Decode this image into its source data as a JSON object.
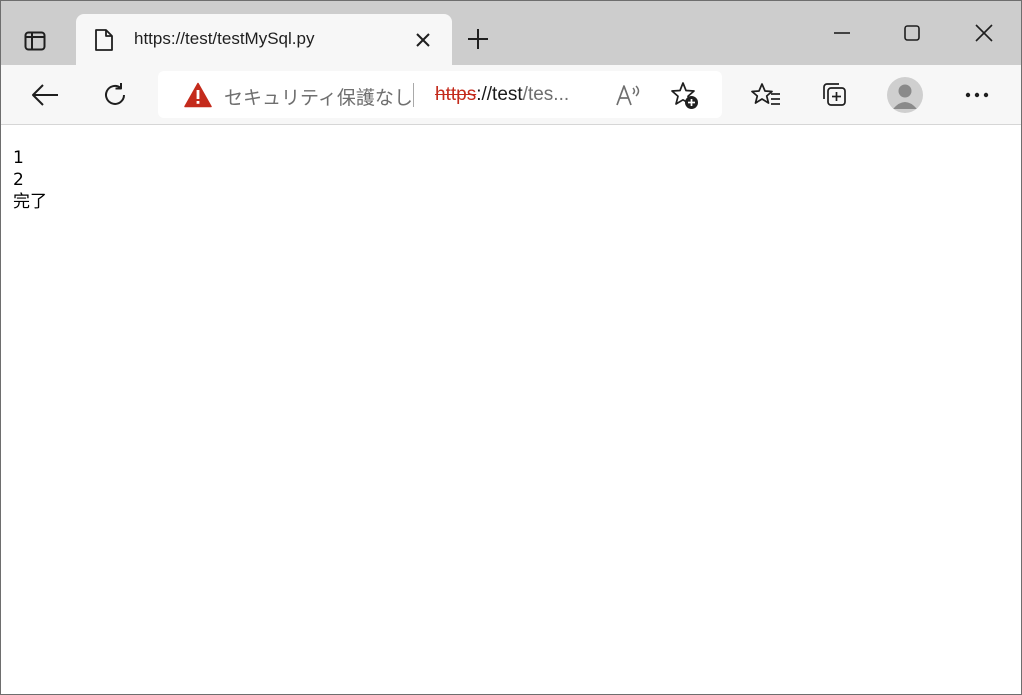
{
  "browser": {
    "tab": {
      "title": "https://test/testMySql.py"
    },
    "address_bar": {
      "security_label": "セキュリティ保護なし",
      "url_scheme": "https",
      "url_host": "://test",
      "url_rest": "/tes..."
    },
    "icons": {
      "tab_actions": "tab-actions-icon",
      "favicon": "document-icon",
      "tab_close": "close-icon",
      "new_tab": "plus-icon",
      "minimize": "minimize-icon",
      "maximize": "maximize-icon",
      "window_close": "close-icon",
      "back": "arrow-left-icon",
      "reload": "reload-icon",
      "warning": "warning-icon",
      "read_aloud": "read-aloud-icon",
      "add_favorite": "star-add-icon",
      "favorites": "favorites-icon",
      "collections": "collections-icon",
      "profile": "profile-avatar",
      "more": "more-icon"
    },
    "colors": {
      "tabstrip": "#cdcdcd",
      "toolbar": "#f7f7f7",
      "warning": "#c42b1c"
    }
  },
  "page": {
    "lines": [
      "1",
      "2",
      "完了"
    ]
  }
}
